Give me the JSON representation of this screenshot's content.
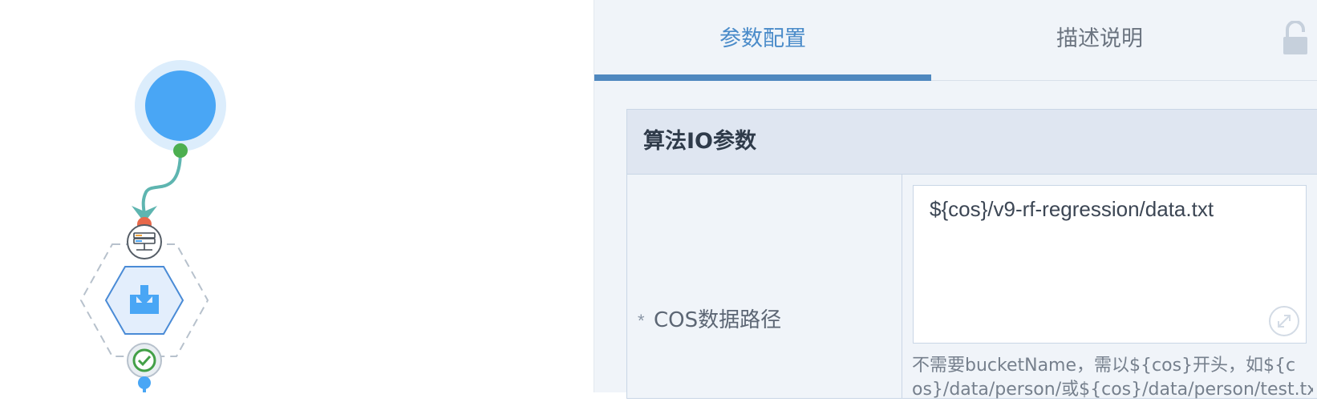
{
  "tabs": [
    {
      "label": "参数配置",
      "active": true
    },
    {
      "label": "描述说明",
      "active": false
    }
  ],
  "lock_icon": "unlocked-padlock-icon",
  "section": {
    "title": "算法IO参数",
    "field": {
      "required_mark": "*",
      "label": "COS数据路径",
      "value": "${cos}/v9-rf-regression/data.txt",
      "hint_line1": "不需要bucketName，需以${cos}开头，如${c",
      "hint_line2": "os}/data/person/或${cos}/data/person/test.tx"
    }
  },
  "canvas": {
    "start_node_icon": "start-circle-icon",
    "data_source_icon": "server-database-icon",
    "input_node_icon": "download-inbox-icon",
    "status_icon": "success-check-icon"
  },
  "colors": {
    "accent": "#4a8bc9",
    "node_blue": "#49a6f5",
    "link_teal": "#5eb5b0",
    "port_green": "#4caf50",
    "port_red": "#e8684a"
  }
}
